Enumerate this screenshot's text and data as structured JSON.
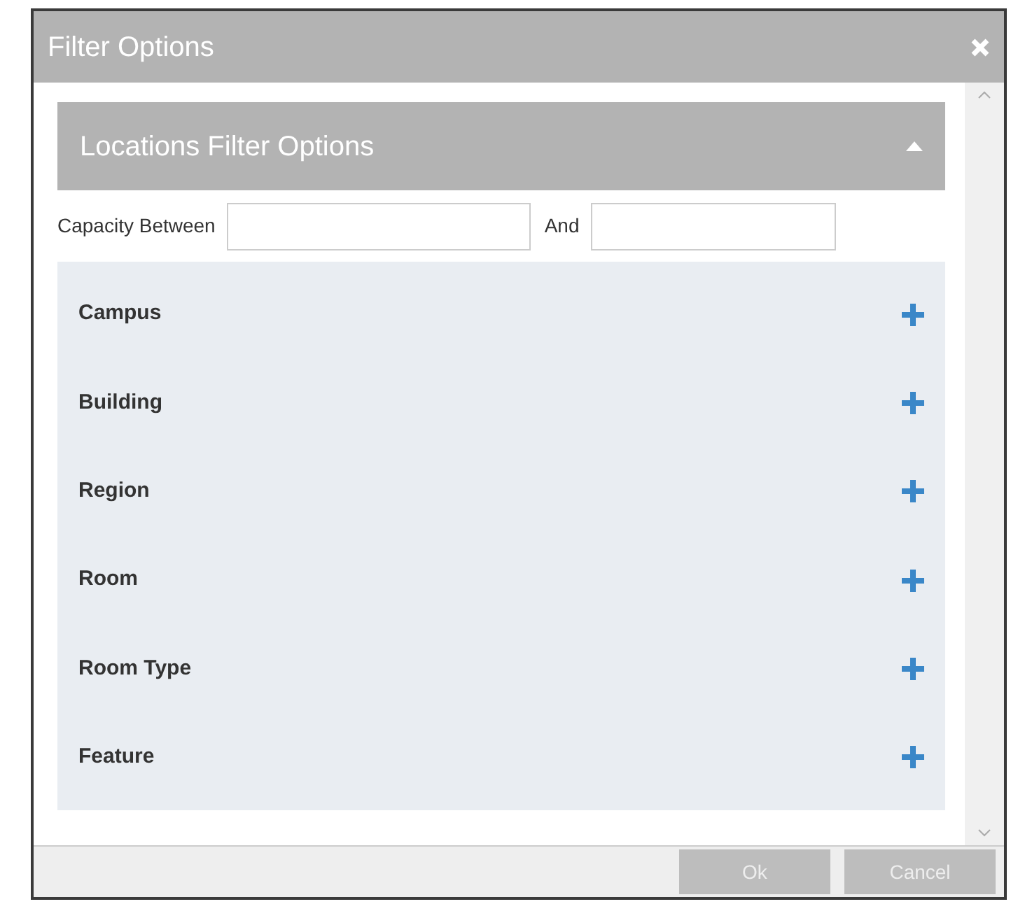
{
  "dialog": {
    "title": "Filter Options"
  },
  "section": {
    "title": "Locations Filter Options",
    "expanded": true
  },
  "capacity": {
    "label": "Capacity Between",
    "and_label": "And"
  },
  "filters": [
    {
      "label": "Campus",
      "expanded": false
    },
    {
      "label": "Building",
      "expanded": false
    },
    {
      "label": "Region",
      "expanded": false
    },
    {
      "label": "Room",
      "expanded": false
    },
    {
      "label": "Room Type",
      "expanded": false
    },
    {
      "label": "Feature",
      "expanded": false
    }
  ],
  "buttons": [
    {
      "label": "Ok",
      "disabled": true
    },
    {
      "label": "Cancel",
      "disabled": true
    }
  ]
}
